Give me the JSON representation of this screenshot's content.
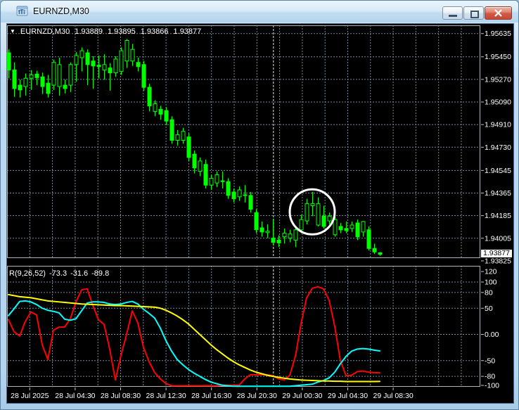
{
  "window": {
    "title": "EURNZD,M30",
    "buttons": {
      "minimize": "minimize",
      "restore": "restore",
      "close": "close"
    }
  },
  "quote_line": {
    "dropdown": "▼",
    "symbol": "EURNZD,M30",
    "open": "1.93889",
    "high": "1.93895",
    "low": "1.93866",
    "close": "1.93877"
  },
  "price_axis": {
    "labels": [
      "1.95635",
      "1.95450",
      "1.95270",
      "1.95090",
      "1.94910",
      "1.94730",
      "1.94545",
      "1.94365",
      "1.94185",
      "1.94005"
    ],
    "last_label": "1.93825",
    "current_price": "1.93877"
  },
  "indicator_panel": {
    "name": "R(9,26,52)",
    "value_1": "-73.3",
    "value_2": "-31.6",
    "value_3": "-89.8",
    "axis_labels": [
      "120",
      "100",
      "80",
      "50",
      "0.00",
      "-50",
      "-80",
      "-100"
    ]
  },
  "time_axis": {
    "labels": [
      "28 Jul 2025",
      "28 Jul 04:30",
      "28 Jul 08:30",
      "28 Jul 12:30",
      "28 Jul 16:30",
      "28 Jul 20:30",
      "29 Jul 00:30",
      "29 Jul 04:30",
      "29 Jul 08:30"
    ]
  },
  "colors": {
    "background": "#000000",
    "grid": "#778899",
    "candle_outline": "#00ff00",
    "bull_fill": "#000000",
    "bear_fill": "#00ff00",
    "separator": "#e8e8e8",
    "border": "#aab4ba",
    "axis_text": "#ffffff",
    "tick": "#c8c8c8",
    "annotation": "#ffffff",
    "indicator_red": "#ff0000",
    "indicator_cyan": "#00ffff",
    "indicator_yellow": "#ffff00"
  },
  "chart_data": {
    "type": "candlestick",
    "symbol": "EURNZD",
    "timeframe": "M30",
    "price_range": {
      "top": 1.95635,
      "bottom": 1.93825
    },
    "candles": [
      [
        1.95482,
        1.95509,
        1.95279,
        1.95345
      ],
      [
        1.95345,
        1.95405,
        1.95131,
        1.95197
      ],
      [
        1.95224,
        1.95268,
        1.95125,
        1.95186
      ],
      [
        1.95213,
        1.95317,
        1.95142,
        1.95279
      ],
      [
        1.95279,
        1.95344,
        1.95186,
        1.95306
      ],
      [
        1.95312,
        1.95339,
        1.95224,
        1.95284
      ],
      [
        1.9529,
        1.95323,
        1.95153,
        1.95213
      ],
      [
        1.9524,
        1.95306,
        1.95125,
        1.95158
      ],
      [
        1.95224,
        1.95427,
        1.95186,
        1.95405
      ],
      [
        1.95213,
        1.95443,
        1.95141,
        1.95388
      ],
      [
        1.95224,
        1.95268,
        1.95158,
        1.95197
      ],
      [
        1.95224,
        1.95405,
        1.95169,
        1.95388
      ],
      [
        1.95388,
        1.95487,
        1.95251,
        1.9546
      ],
      [
        1.95443,
        1.95525,
        1.95333,
        1.95498
      ],
      [
        1.95482,
        1.95509,
        1.95224,
        1.95388
      ],
      [
        1.95416,
        1.95454,
        1.95196,
        1.95377
      ],
      [
        1.95383,
        1.9546,
        1.95278,
        1.95372
      ],
      [
        1.95344,
        1.9547,
        1.95268,
        1.95388
      ],
      [
        1.95361,
        1.95399,
        1.9518,
        1.95322
      ],
      [
        1.95322,
        1.95454,
        1.9529,
        1.95432
      ],
      [
        1.95333,
        1.95525,
        1.95306,
        1.95498
      ],
      [
        1.95416,
        1.95591,
        1.95361,
        1.9558
      ],
      [
        1.95416,
        1.95553,
        1.95377,
        1.95509
      ],
      [
        1.95405,
        1.95443,
        1.95333,
        1.95372
      ],
      [
        1.95388,
        1.95416,
        1.9518,
        1.95207
      ],
      [
        1.95207,
        1.95235,
        1.95015,
        1.95059
      ],
      [
        1.95015,
        1.95103,
        1.94977,
        1.95076
      ],
      [
        1.95032,
        1.95059,
        1.94949,
        1.94993
      ],
      [
        1.95021,
        1.95048,
        1.94906,
        1.94938
      ],
      [
        1.94949,
        1.94977,
        1.94757,
        1.94785
      ],
      [
        1.94785,
        1.94867,
        1.94741,
        1.94829
      ],
      [
        1.94785,
        1.94884,
        1.94757,
        1.94856
      ],
      [
        1.94812,
        1.9484,
        1.9462,
        1.94648
      ],
      [
        1.94675,
        1.94703,
        1.94522,
        1.94565
      ],
      [
        1.94538,
        1.94648,
        1.945,
        1.9462
      ],
      [
        1.94593,
        1.94631,
        1.94401,
        1.94428
      ],
      [
        1.94428,
        1.94511,
        1.9439,
        1.94483
      ],
      [
        1.94445,
        1.94538,
        1.94412,
        1.94511
      ],
      [
        1.94462,
        1.94538,
        1.94401,
        1.94456
      ],
      [
        1.94456,
        1.94483,
        1.94319,
        1.94346
      ],
      [
        1.94373,
        1.94401,
        1.94291,
        1.94319
      ],
      [
        1.94335,
        1.94417,
        1.94302,
        1.9439
      ],
      [
        1.94351,
        1.94428,
        1.94291,
        1.94346
      ],
      [
        1.94346,
        1.94373,
        1.94209,
        1.94236
      ],
      [
        1.94209,
        1.94236,
        1.94045,
        1.94073
      ],
      [
        1.94088,
        1.94138,
        1.94017,
        1.94055
      ],
      [
        1.9405,
        1.94116,
        1.94006,
        1.94061
      ],
      [
        1.94006,
        1.94154,
        1.93951,
        1.93973
      ],
      [
        1.9399,
        1.94028,
        1.93935,
        1.93968
      ],
      [
        1.94017,
        1.94083,
        1.93962,
        1.94045
      ],
      [
        1.94006,
        1.94072,
        1.93973,
        1.94039
      ],
      [
        1.9399,
        1.94099,
        1.93935,
        1.94072
      ],
      [
        1.94072,
        1.94192,
        1.94045,
        1.94154
      ],
      [
        1.94143,
        1.94319,
        1.94116,
        1.9428
      ],
      [
        1.94264,
        1.94374,
        1.94181,
        1.9428
      ],
      [
        1.9411,
        1.9433,
        1.94099,
        1.9428
      ],
      [
        1.94181,
        1.94264,
        1.94083,
        1.94099
      ],
      [
        1.94143,
        1.94209,
        1.94116,
        1.94181
      ],
      [
        1.94033,
        1.94181,
        1.94017,
        1.94154
      ],
      [
        1.94099,
        1.94127,
        1.94045,
        1.94072
      ],
      [
        1.94083,
        1.94138,
        1.94045,
        1.94066
      ],
      [
        1.94083,
        1.94138,
        1.94055,
        1.9411
      ],
      [
        1.94127,
        1.94154,
        1.9399,
        1.94017
      ],
      [
        1.94055,
        1.94143,
        1.94017,
        1.94138
      ],
      [
        1.94072,
        1.94099,
        1.93907,
        1.93924
      ],
      [
        1.93924,
        1.93962,
        1.9388,
        1.93896
      ],
      [
        1.93889,
        1.93895,
        1.93866,
        1.93877
      ]
    ],
    "day_separator_bar": 47.1,
    "annotation_circle": {
      "bar_index": 54,
      "center_price": 1.94215,
      "radius_px": 32
    },
    "indicator": {
      "name": "R(9,26,52)",
      "range": [
        -100,
        120
      ],
      "levels": [
        100,
        80,
        50,
        0,
        -50,
        -80
      ],
      "series": [
        {
          "name": "red",
          "color_key": "indicator_red",
          "values": [
            28,
            5,
            -3,
            25,
            43,
            37,
            -20,
            -48,
            8,
            14,
            14,
            30,
            62,
            85,
            87,
            55,
            28,
            19,
            -28,
            -87,
            -40,
            0,
            45,
            22,
            -25,
            -52,
            -73,
            -85,
            -94,
            -98,
            -98,
            -98,
            -98,
            -98,
            -98,
            -98,
            -98,
            -98,
            -97,
            -97,
            -97,
            -97,
            -85,
            -77,
            -77,
            -77,
            -77,
            -79,
            -85,
            -87,
            -78,
            -42,
            20,
            70,
            88,
            91,
            87,
            65,
            15,
            -50,
            -79,
            -78,
            -71,
            -70,
            -72,
            -73,
            -73.3
          ]
        },
        {
          "name": "cyan",
          "color_key": "indicator_cyan",
          "values": [
            36,
            49,
            63,
            64,
            62,
            57,
            50,
            46,
            44,
            41,
            29,
            27,
            30,
            45,
            60,
            62,
            62,
            61,
            58,
            57,
            58,
            61,
            63,
            58,
            48,
            40,
            31,
            12,
            -12,
            -32,
            -48,
            -58,
            -67,
            -74,
            -80,
            -86,
            -91,
            -94,
            -97,
            -98,
            -99,
            -99,
            -99,
            -99,
            -99,
            -99,
            -99,
            -99,
            -99,
            -99,
            -99,
            -98,
            -97,
            -96,
            -95,
            -91,
            -88,
            -83,
            -72,
            -56,
            -42,
            -32,
            -28,
            -27,
            -28,
            -30,
            -31.6
          ]
        },
        {
          "name": "yellow",
          "color_key": "indicator_yellow",
          "values": [
            76,
            74,
            72,
            71,
            70,
            68,
            66,
            64,
            63,
            62,
            61,
            60,
            59,
            58,
            57.5,
            57,
            56.5,
            56,
            55.5,
            55,
            55,
            54.5,
            54,
            53.5,
            53,
            52.5,
            52,
            50,
            46,
            41,
            35,
            28,
            20,
            10,
            0,
            -10,
            -20,
            -29,
            -37,
            -45,
            -52,
            -58,
            -63,
            -68,
            -72,
            -75,
            -78,
            -80,
            -82,
            -83.5,
            -85,
            -86,
            -87,
            -87.5,
            -88,
            -88.5,
            -89,
            -89,
            -89.5,
            -89.5,
            -90,
            -90,
            -90,
            -90,
            -90,
            -90,
            -89.8
          ]
        }
      ]
    }
  }
}
